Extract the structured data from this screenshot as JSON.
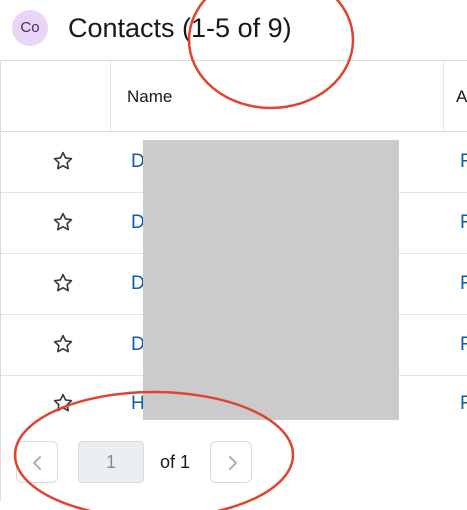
{
  "header": {
    "avatar_initials": "Co",
    "title": "Contacts (1-5 of 9)"
  },
  "table": {
    "columns": [
      "",
      "Name",
      "A"
    ],
    "rows": [
      {
        "name": "D",
        "extra": "F"
      },
      {
        "name": "D",
        "extra": "F"
      },
      {
        "name": "D",
        "extra": "F"
      },
      {
        "name": "D",
        "extra": "F"
      },
      {
        "name": "H",
        "extra": "F"
      }
    ]
  },
  "pagination": {
    "current_page": "1",
    "of_label": "of 1",
    "prev_icon": "chevron-left-icon",
    "next_icon": "chevron-right-icon"
  },
  "icons": {
    "row_icon": "star-icon"
  },
  "colors": {
    "link": "#0b5cab",
    "annotation": "#e0432e",
    "redaction": "#cbcbcb",
    "avatar_bg": "#e9d5f5"
  }
}
